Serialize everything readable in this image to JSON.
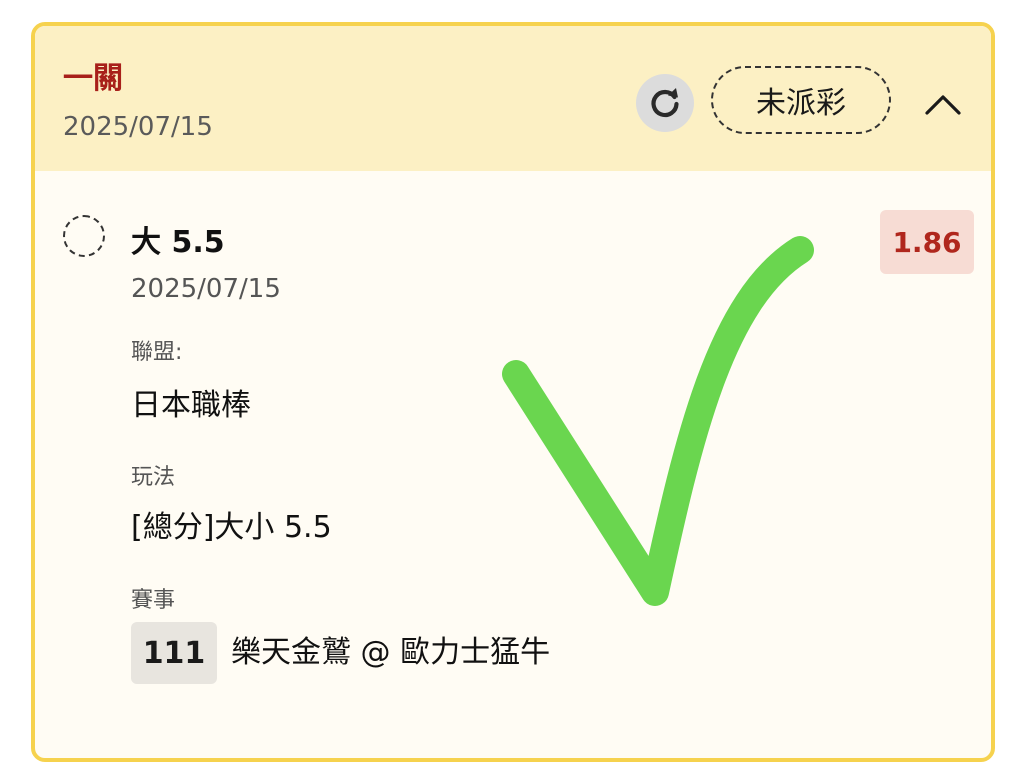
{
  "header": {
    "bet_type": "一關",
    "date": "2025/07/15",
    "status": "未派彩"
  },
  "selection": {
    "name": "大 5.5",
    "date": "2025/07/15",
    "odds": "1.86"
  },
  "fields": {
    "league_label": "聯盟:",
    "league_value": "日本職棒",
    "play_label": "玩法",
    "play_value": "[總分]大小 5.5",
    "match_label": "賽事",
    "match_number": "111",
    "match_name": "樂天金鷲 @ 歐力士猛牛"
  },
  "icons": {
    "refresh": "refresh-icon",
    "collapse": "chevron-up-icon",
    "check": "check-mark-icon"
  },
  "colors": {
    "header_bg": "#fcf0c4",
    "card_border": "#f6d24e",
    "bet_type": "#a8201a",
    "odds_text": "#b0271d",
    "odds_bg": "#f7dcd4",
    "check_mark": "#6ad64f"
  }
}
